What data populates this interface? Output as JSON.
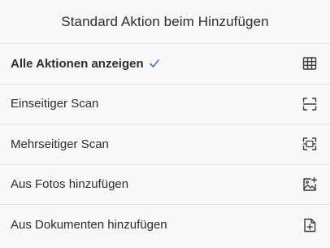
{
  "sheet": {
    "title": "Standard Aktion beim Hinzufügen"
  },
  "options": [
    {
      "label": "Alle Aktionen anzeigen",
      "icon": "grid-icon",
      "selected": true
    },
    {
      "label": "Einseitiger Scan",
      "icon": "scan-single-icon",
      "selected": false
    },
    {
      "label": "Mehrseitiger Scan",
      "icon": "scan-multi-icon",
      "selected": false
    },
    {
      "label": "Aus Fotos hinzufügen",
      "icon": "add-photo-icon",
      "selected": false
    },
    {
      "label": "Aus Dokumenten hinzufügen",
      "icon": "add-document-icon",
      "selected": false
    }
  ],
  "colors": {
    "accent": "#4a6cc9",
    "text": "#2c2c2e",
    "icon": "#3a3a3c",
    "divider": "#e3e3e6",
    "background": "#f8f8f8"
  }
}
